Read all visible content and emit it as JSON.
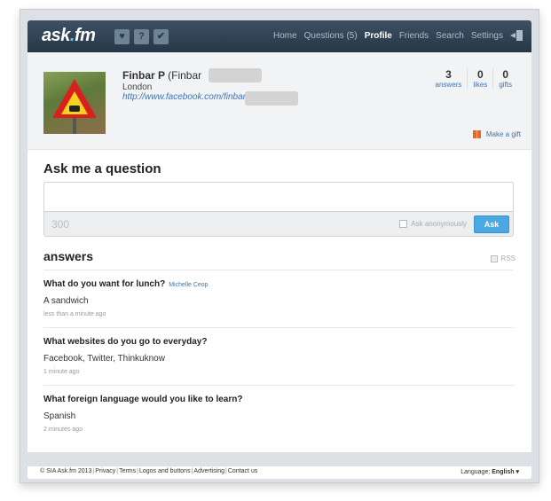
{
  "header": {
    "logo_main": "ask",
    "logo_dot": ".",
    "logo_tail": "fm",
    "icon_question": "?",
    "nav": [
      {
        "label": "Home"
      },
      {
        "label": "Questions (5)"
      },
      {
        "label": "Profile"
      },
      {
        "label": "Friends"
      },
      {
        "label": "Search"
      },
      {
        "label": "Settings"
      }
    ],
    "active_nav": "Profile"
  },
  "profile": {
    "name": "Finbar P",
    "name_paren": "(Finbar",
    "location": "London",
    "url": "http://www.facebook.com/finbar",
    "stats": [
      {
        "value": "3",
        "label": "answers"
      },
      {
        "value": "0",
        "label": "likes"
      },
      {
        "value": "0",
        "label": "gifts"
      }
    ],
    "gift_link": "Make a gift"
  },
  "ask": {
    "title": "Ask me a question",
    "char_count": "300",
    "anonymous_label": "Ask anonymously",
    "button_label": "Ask"
  },
  "answers": {
    "title": "answers",
    "rss_label": "RSS",
    "items": [
      {
        "question": "What do you want for lunch?",
        "asker": "Michelle Ceop",
        "answer": "A sandwich",
        "time": "less than a minute ago"
      },
      {
        "question": "What websites do you go to everyday?",
        "asker": "",
        "answer": "Facebook, Twitter, Thinkuknow",
        "time": "1 minute ago"
      },
      {
        "question": "What foreign language would you like to learn?",
        "asker": "",
        "answer": "Spanish",
        "time": "2 minutes ago"
      }
    ]
  },
  "footer": {
    "links": [
      "© SIA Ask.fm 2013",
      "Privacy",
      "Terms",
      "Logos and buttons",
      "Advertising",
      "Contact us"
    ],
    "language_label": "Language:",
    "language_value": "English ▾"
  },
  "colors": {
    "topbar": "#2f4254",
    "accent_blue": "#4aa8e3",
    "link_blue": "#3b74b8",
    "gift_orange": "#e46a2b"
  }
}
